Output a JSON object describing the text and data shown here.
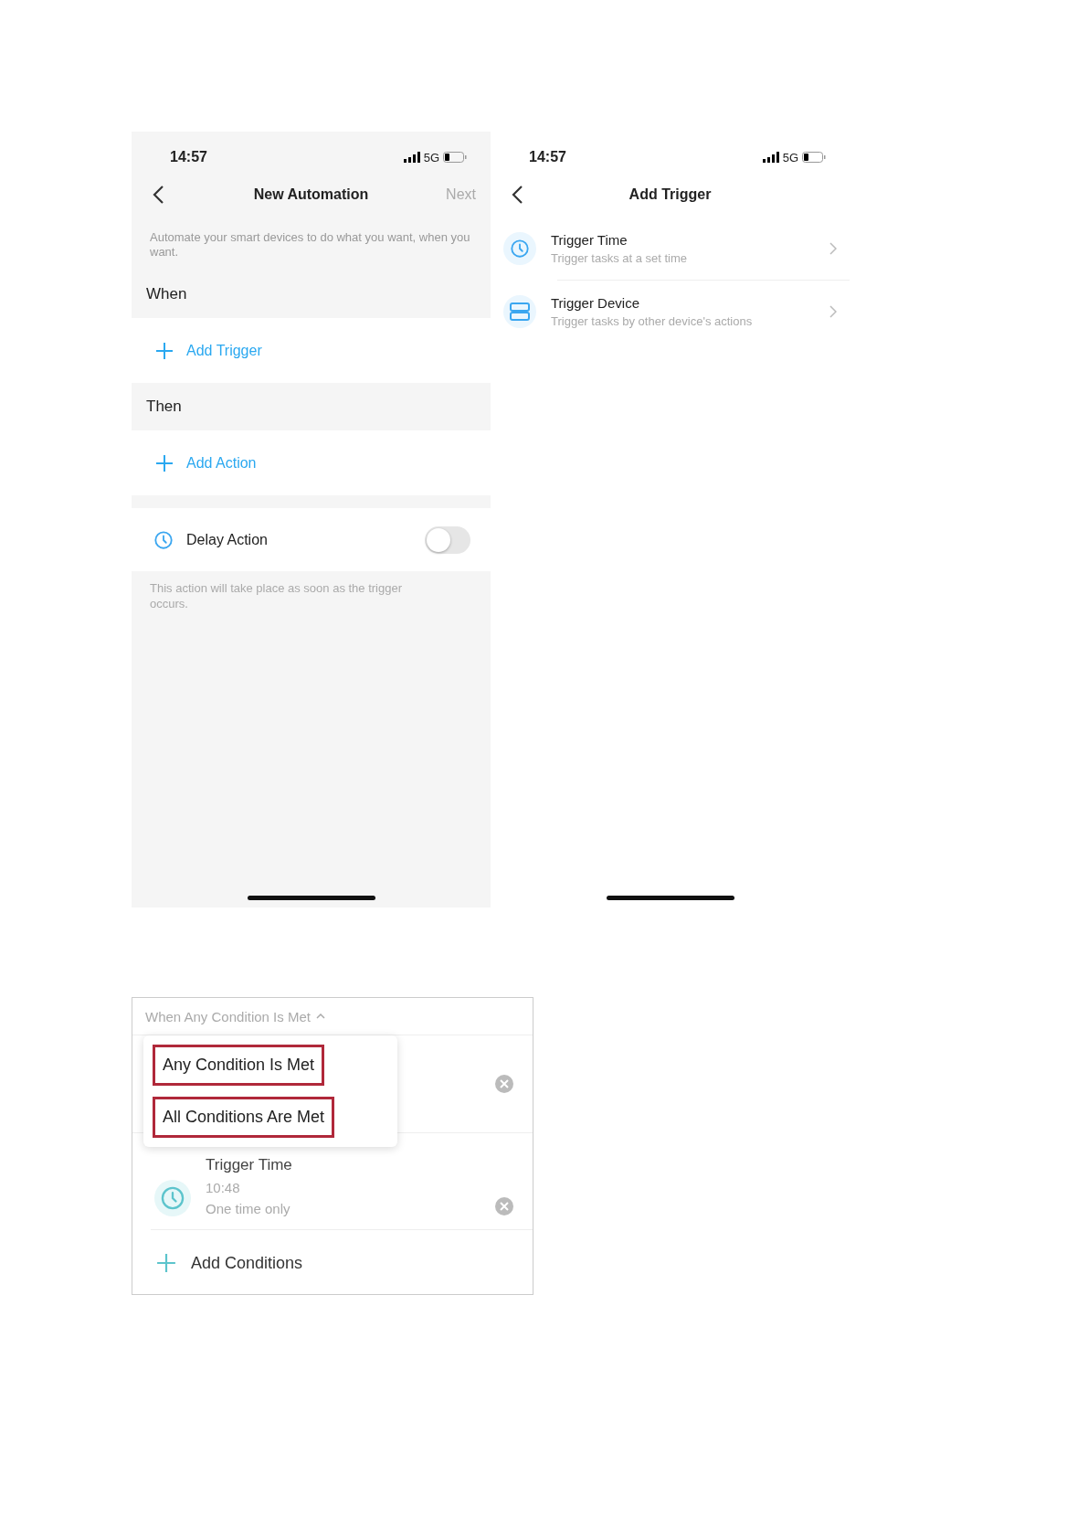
{
  "new_automation_screen": {
    "status_bar": {
      "time": "14:57",
      "network": "5G"
    },
    "title": "New Automation",
    "next": {
      "label": "Next",
      "disabled": true
    },
    "description": "Automate your smart devices to do what you want, when you want.",
    "when": {
      "heading": "When",
      "add_label": "Add Trigger"
    },
    "then": {
      "heading": "Then",
      "add_label": "Add Action"
    },
    "delay": {
      "label": "Delay Action",
      "on": false,
      "note": "This action will take place as soon as the trigger occurs."
    }
  },
  "add_trigger_screen": {
    "status_bar": {
      "time": "14:57",
      "network": "5G"
    },
    "title": "Add Trigger",
    "options": [
      {
        "kind": "time",
        "title": "Trigger Time",
        "subtitle": "Trigger tasks at a set time"
      },
      {
        "kind": "device",
        "title": "Trigger Device",
        "subtitle": "Trigger tasks by other device's actions"
      }
    ]
  },
  "conditions_panel": {
    "dropdown": {
      "label": "When Any Condition Is Met",
      "expanded": true,
      "options": [
        "Any Condition Is Met",
        "All Conditions Are Met"
      ]
    },
    "conditions": [
      {
        "kind": "hidden"
      },
      {
        "kind": "time",
        "title": "Trigger Time",
        "time": "10:48",
        "repeat": "One time only"
      }
    ],
    "add_label": "Add Conditions"
  }
}
